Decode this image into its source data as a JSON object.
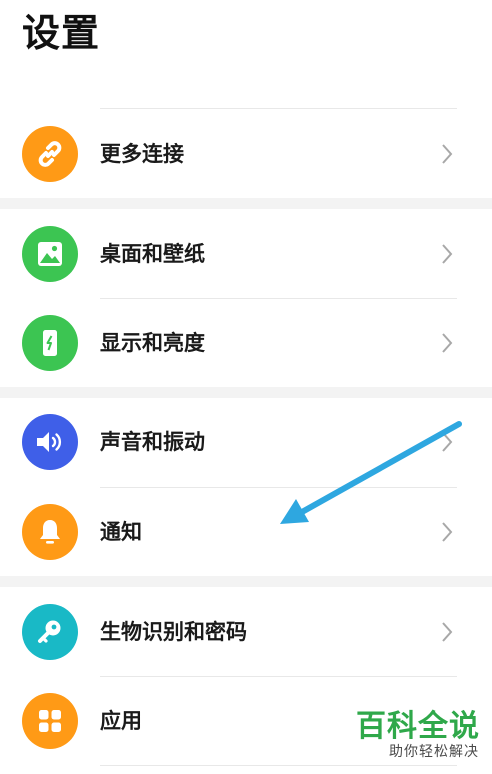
{
  "header": {
    "title": "设置"
  },
  "items": [
    {
      "label": "更多连接",
      "icon": "link-icon",
      "color": "#ff9a16"
    },
    {
      "label": "桌面和壁纸",
      "icon": "wallpaper-icon",
      "color": "#3cc552"
    },
    {
      "label": "显示和亮度",
      "icon": "display-icon",
      "color": "#3cc552"
    },
    {
      "label": "声音和振动",
      "icon": "speaker-icon",
      "color": "#3f5fe8"
    },
    {
      "label": "通知",
      "icon": "bell-icon",
      "color": "#ff9a16"
    },
    {
      "label": "生物识别和密码",
      "icon": "key-icon",
      "color": "#19b9c6"
    },
    {
      "label": "应用",
      "icon": "apps-grid-icon",
      "color": "#ff9a16"
    }
  ],
  "annotation": {
    "arrow": "blue-arrow-pointing-to-notification",
    "color": "#2ea7e0"
  },
  "watermark": {
    "brand": "百科全说",
    "slogan": "助你轻松解决"
  }
}
